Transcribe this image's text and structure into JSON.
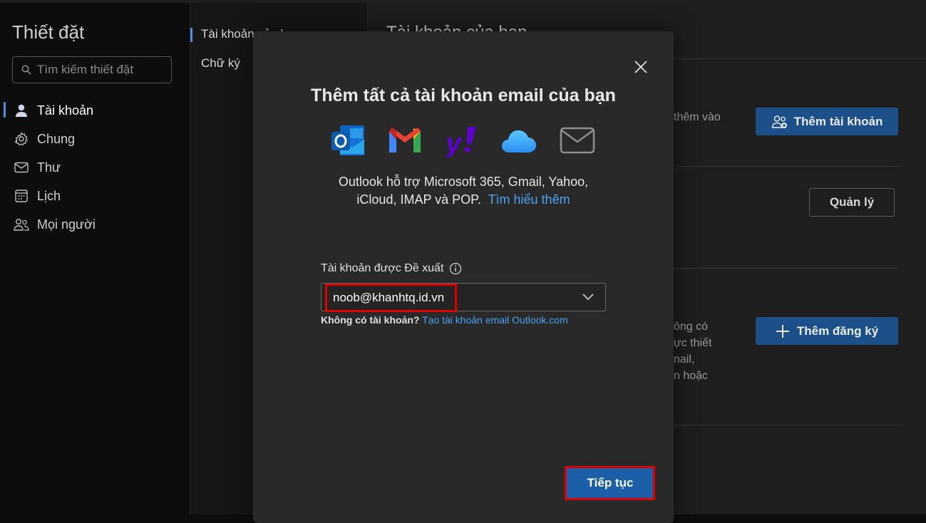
{
  "sidebar": {
    "title": "Thiết đặt",
    "search_placeholder": "Tìm kiếm thiết đặt",
    "items": [
      {
        "label": "Tài khoản",
        "icon": "person-icon"
      },
      {
        "label": "Chung",
        "icon": "gear-icon"
      },
      {
        "label": "Thư",
        "icon": "mail-icon"
      },
      {
        "label": "Lịch",
        "icon": "calendar-icon"
      },
      {
        "label": "Mọi người",
        "icon": "people-icon"
      }
    ]
  },
  "subnav": {
    "items": [
      "Tài khoản của b",
      "Chữ ký"
    ]
  },
  "main": {
    "title": "Tài khoản của bạn",
    "section1_text": "thêm vào",
    "add_account_button": "Thêm tài khoản",
    "manage_button": "Quản lý",
    "section3_lines": [
      "ông có",
      "ực thiết",
      "nail,",
      "n hoặc"
    ],
    "add_subscription_button": "Thêm đăng ký"
  },
  "modal": {
    "title": "Thêm tất cả tài khoản email của bạn",
    "providers": [
      "outlook-icon",
      "gmail-icon",
      "yahoo-icon",
      "icloud-icon",
      "generic-mail-icon"
    ],
    "support_line1": "Outlook hỗ trợ Microsoft 365, Gmail, Yahoo,",
    "support_line2": "iCloud, IMAP và POP.",
    "learn_more": "Tìm hiểu thêm",
    "field_label": "Tài khoản được Đề xuất",
    "selected_account": "noob@khanhtq.id.vn",
    "no_account_text": "Không có tài khoản?",
    "create_account_link": "Tạo tài khoản email Outlook.com",
    "continue_button": "Tiếp tục"
  },
  "colors": {
    "accent": "#1a5fa8",
    "link": "#4aa3f0",
    "highlight": "#e00000"
  }
}
